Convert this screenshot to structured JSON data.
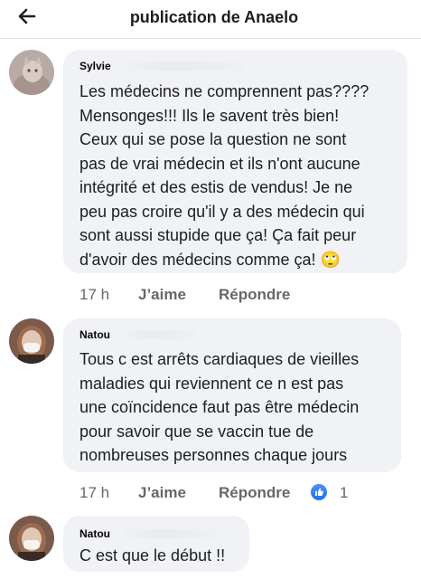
{
  "header": {
    "title": "publication de Anaelo"
  },
  "comments": [
    {
      "author": "Sylvie",
      "text_lines": [
        "Les médecins ne comprennent pas????",
        "Mensonges!!! Ils le savent très bien!",
        "Ceux qui se pose la question ne sont",
        "pas de vrai médecin et ils n'ont aucune",
        "intégrité et des estis de vendus! Je ne",
        "peu pas croire qu'il y a des médecin qui",
        "sont aussi stupide que ça! Ça fait peur",
        "d'avoir des médecins comme ça! 🙄"
      ],
      "time": "17 h",
      "like_label": "J’aime",
      "reply_label": "Répondre"
    },
    {
      "author": "Natou",
      "text_lines": [
        "Tous c est arrêts cardiaques de vieilles",
        "maladies qui reviennent ce n est pas",
        "une coïncidence faut pas être médecin",
        "pour savoir que se vaccin tue de",
        "nombreuses personnes chaque jours"
      ],
      "time": "17 h",
      "like_label": "J’aime",
      "reply_label": "Répondre",
      "reaction_icon": "like-icon",
      "reaction_count": "1"
    },
    {
      "author": "Natou",
      "text_lines": [
        "C est que le début !!"
      ]
    }
  ],
  "colors": {
    "bubble": "#f0f2f5",
    "meta": "#65676b",
    "like_blue": "#1877f2"
  }
}
